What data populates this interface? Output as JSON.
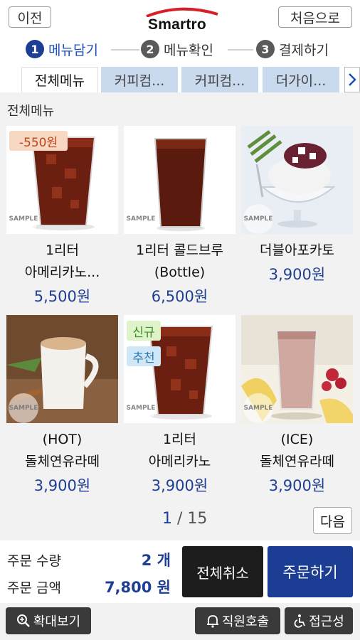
{
  "header": {
    "prev_label": "이전",
    "logo_text": "Smartro",
    "home_label": "처음으로"
  },
  "steps": [
    {
      "num": "1",
      "label": "메뉴담기",
      "active": true
    },
    {
      "num": "2",
      "label": "메뉴확인",
      "active": false
    },
    {
      "num": "3",
      "label": "결제하기",
      "active": false
    }
  ],
  "tabs": [
    {
      "label": "전체메뉴",
      "active": true
    },
    {
      "label": "커피컴...",
      "active": false
    },
    {
      "label": "커피컴...",
      "active": false
    },
    {
      "label": "더가이...",
      "active": false
    }
  ],
  "section_title": "전체메뉴",
  "sample_text": "SAMPLE",
  "products": [
    {
      "name_line1": "1리터",
      "name_line2": "아메리카노...",
      "price": "5,500원",
      "badge": "-550원",
      "image": "iced-americano-glass"
    },
    {
      "name_line1": "1리터 콜드브루",
      "name_line2": "(Bottle)",
      "price": "6,500원",
      "badge": "",
      "image": "cold-brew-glass"
    },
    {
      "name_line1": "더블아포카토",
      "name_line2": "",
      "price": "3,900원",
      "badge": "",
      "image": "affogato-bowl"
    },
    {
      "name_line1": "(HOT)",
      "name_line2": "돌체연유라떼",
      "price": "3,900원",
      "badge": "",
      "image": "hot-latte-mug"
    },
    {
      "name_line1": "1리터",
      "name_line2": "아메리카노",
      "price": "3,900원",
      "badges": [
        "신규",
        "추천"
      ],
      "image": "iced-americano-glass"
    },
    {
      "name_line1": "(ICE)",
      "name_line2": "돌체연유라떼",
      "price": "3,900원",
      "badge": "",
      "image": "iced-latte-glass"
    }
  ],
  "pager": {
    "current": "1",
    "separator": " / ",
    "total": "15",
    "next_label": "다음"
  },
  "summary": {
    "qty_label": "주문 수량",
    "qty_value": "2 개",
    "amount_label": "주문 금액",
    "amount_value": "7,800 원",
    "cancel_all_label": "전체취소",
    "order_label": "주문하기"
  },
  "footer": {
    "zoom_label": "확대보기",
    "call_staff_label": "직원호출",
    "accessibility_label": "접근성"
  },
  "colors": {
    "accent": "#1c3f94",
    "price": "#1f3f95",
    "tab_inactive": "#c9d9ee",
    "order_button": "#1b3d94",
    "cancel_button": "#1d1d1d"
  }
}
